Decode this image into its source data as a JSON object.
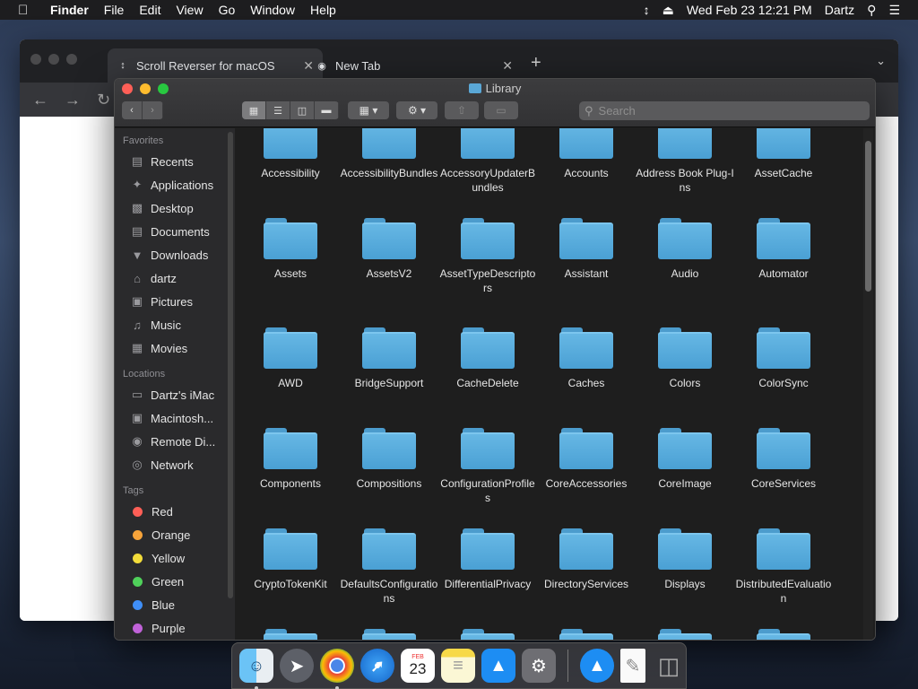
{
  "menubar": {
    "items": [
      "Finder",
      "File",
      "Edit",
      "View",
      "Go",
      "Window",
      "Help"
    ],
    "clock": "Wed Feb 23  12:21 PM",
    "user": "Dartz"
  },
  "chrome": {
    "tab1": "Scroll Reverser for macOS",
    "tab2": "New Tab"
  },
  "finder": {
    "title": "Library",
    "search_placeholder": "Search",
    "sidebar": {
      "favorites_head": "Favorites",
      "favorites": [
        "Recents",
        "Applications",
        "Desktop",
        "Documents",
        "Downloads",
        "dartz",
        "Pictures",
        "Music",
        "Movies"
      ],
      "locations_head": "Locations",
      "locations": [
        "Dartz's iMac",
        "Macintosh...",
        "Remote Di...",
        "Network"
      ],
      "tags_head": "Tags",
      "tags": [
        {
          "label": "Red",
          "color": "#fe5f57"
        },
        {
          "label": "Orange",
          "color": "#f6a33a"
        },
        {
          "label": "Yellow",
          "color": "#f2dc3a"
        },
        {
          "label": "Green",
          "color": "#4fd05a"
        },
        {
          "label": "Blue",
          "color": "#3f8ef7"
        },
        {
          "label": "Purple",
          "color": "#c062d8"
        }
      ]
    },
    "folders": [
      "Accessibility",
      "AccessibilityBundles",
      "AccessoryUpdaterBundles",
      "Accounts",
      "Address Book Plug-Ins",
      "AssetCache",
      "Assets",
      "AssetsV2",
      "AssetTypeDescriptors",
      "Assistant",
      "Audio",
      "Automator",
      "AWD",
      "BridgeSupport",
      "CacheDelete",
      "Caches",
      "Colors",
      "ColorSync",
      "Components",
      "Compositions",
      "ConfigurationProfiles",
      "CoreAccessories",
      "CoreImage",
      "CoreServices",
      "CryptoTokenKit",
      "DefaultsConfigurations",
      "DifferentialPrivacy",
      "DirectoryServices",
      "Displays",
      "DistributedEvaluation",
      "",
      "",
      "",
      "",
      "",
      ""
    ]
  },
  "dock": {
    "apps": [
      "Finder",
      "Launchpad",
      "Chrome",
      "Safari",
      "Calendar",
      "Notes",
      "App Store",
      "System Preferences",
      "Downloads",
      "Document",
      "Trash"
    ],
    "calendar_month": "FEB",
    "calendar_day": "23"
  }
}
